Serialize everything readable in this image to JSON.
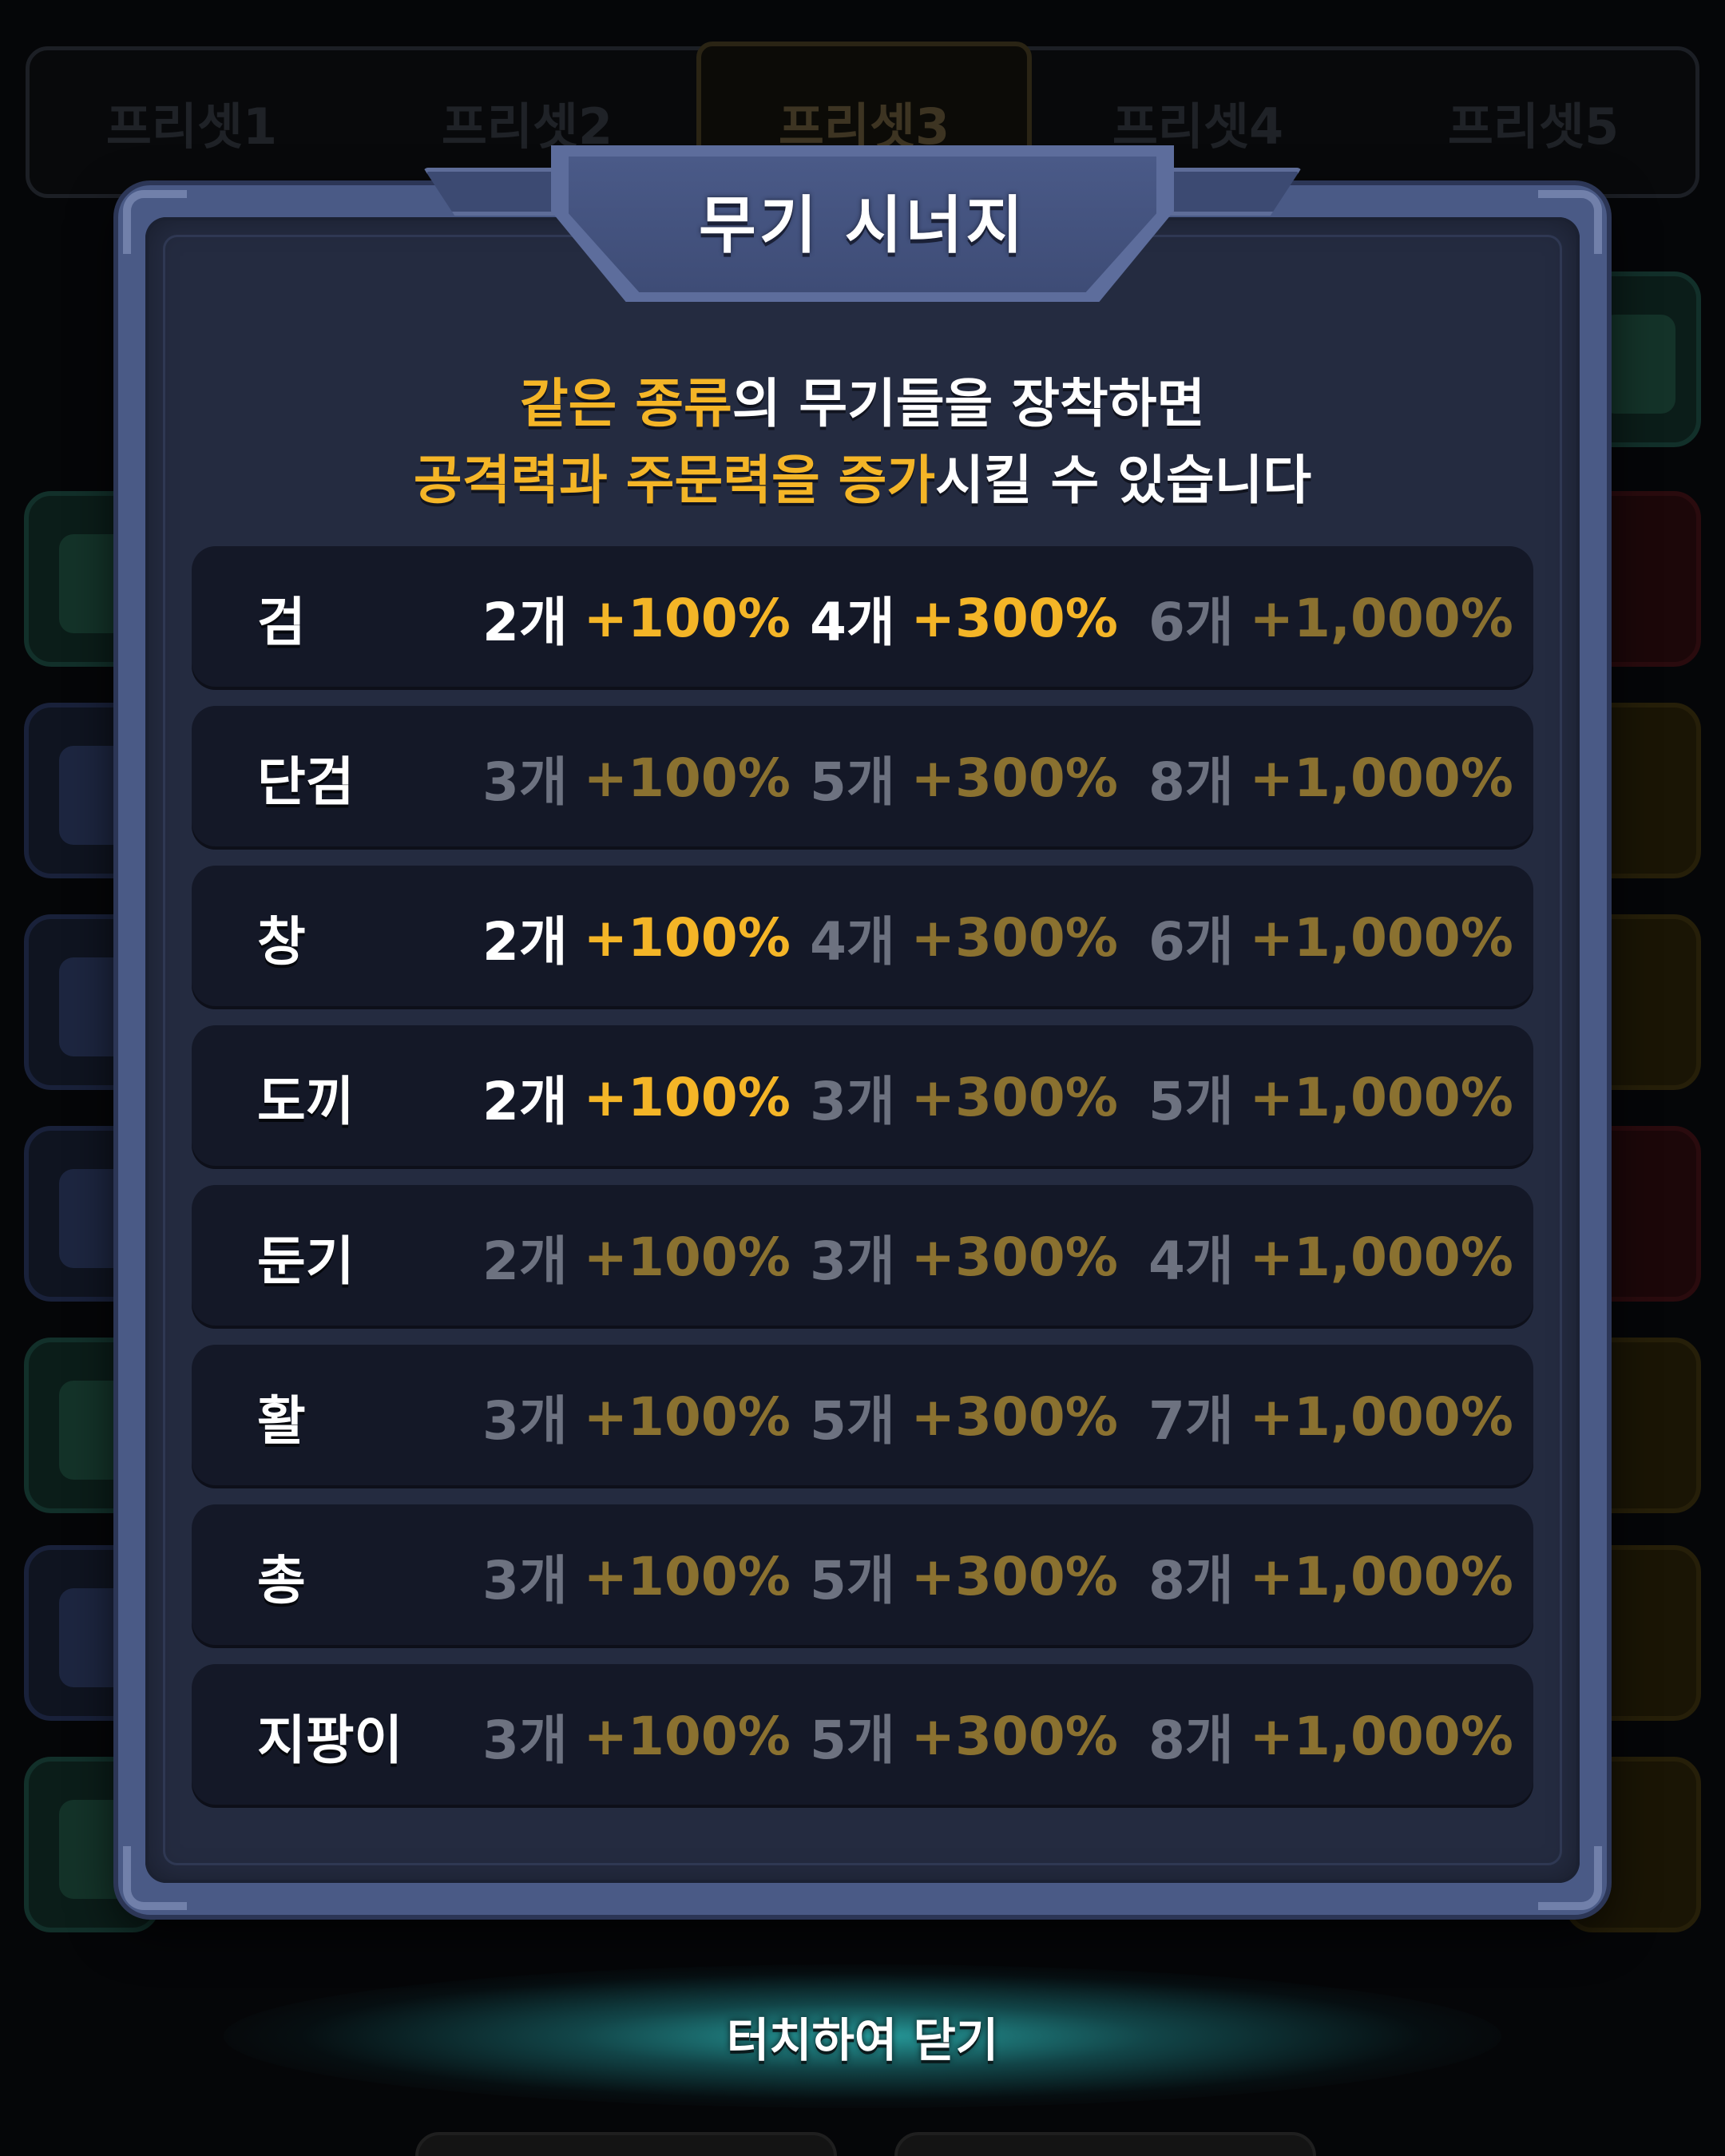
{
  "presets": {
    "tabs": [
      "프리셋1",
      "프리셋2",
      "프리셋3",
      "프리셋4",
      "프리셋5"
    ],
    "active_index": 2
  },
  "modal": {
    "title": "무기 시너지",
    "description": {
      "line1": [
        {
          "text": "같은 종류",
          "highlight": true
        },
        {
          "text": "의 무기들을 장착하면",
          "highlight": false
        }
      ],
      "line2": [
        {
          "text": "공격력과 주문력을 증가",
          "highlight": true
        },
        {
          "text": "시킬 수 있습니다",
          "highlight": false
        }
      ]
    },
    "rows": [
      {
        "name": "검",
        "tiers": [
          {
            "count": "2개",
            "bonus": "+100%",
            "active": true
          },
          {
            "count": "4개",
            "bonus": "+300%",
            "active": true
          },
          {
            "count": "6개",
            "bonus": "+1,000%",
            "active": false
          }
        ]
      },
      {
        "name": "단검",
        "tiers": [
          {
            "count": "3개",
            "bonus": "+100%",
            "active": false
          },
          {
            "count": "5개",
            "bonus": "+300%",
            "active": false
          },
          {
            "count": "8개",
            "bonus": "+1,000%",
            "active": false
          }
        ]
      },
      {
        "name": "창",
        "tiers": [
          {
            "count": "2개",
            "bonus": "+100%",
            "active": true
          },
          {
            "count": "4개",
            "bonus": "+300%",
            "active": false
          },
          {
            "count": "6개",
            "bonus": "+1,000%",
            "active": false
          }
        ]
      },
      {
        "name": "도끼",
        "tiers": [
          {
            "count": "2개",
            "bonus": "+100%",
            "active": true
          },
          {
            "count": "3개",
            "bonus": "+300%",
            "active": false
          },
          {
            "count": "5개",
            "bonus": "+1,000%",
            "active": false
          }
        ]
      },
      {
        "name": "둔기",
        "tiers": [
          {
            "count": "2개",
            "bonus": "+100%",
            "active": false
          },
          {
            "count": "3개",
            "bonus": "+300%",
            "active": false
          },
          {
            "count": "4개",
            "bonus": "+1,000%",
            "active": false
          }
        ]
      },
      {
        "name": "활",
        "tiers": [
          {
            "count": "3개",
            "bonus": "+100%",
            "active": false
          },
          {
            "count": "5개",
            "bonus": "+300%",
            "active": false
          },
          {
            "count": "7개",
            "bonus": "+1,000%",
            "active": false
          }
        ]
      },
      {
        "name": "총",
        "tiers": [
          {
            "count": "3개",
            "bonus": "+100%",
            "active": false
          },
          {
            "count": "5개",
            "bonus": "+300%",
            "active": false
          },
          {
            "count": "8개",
            "bonus": "+1,000%",
            "active": false
          }
        ]
      },
      {
        "name": "지팡이",
        "tiers": [
          {
            "count": "3개",
            "bonus": "+100%",
            "active": false
          },
          {
            "count": "5개",
            "bonus": "+300%",
            "active": false
          },
          {
            "count": "8개",
            "bonus": "+1,000%",
            "active": false
          }
        ]
      }
    ]
  },
  "close_label": "터치하여 닫기",
  "colors": {
    "highlight": "#f4b527",
    "active_count": "#ffffff",
    "inactive_count": "#6d7280",
    "inactive_bonus": "#8a7130",
    "panel": "#242b40",
    "row": "#141827"
  }
}
